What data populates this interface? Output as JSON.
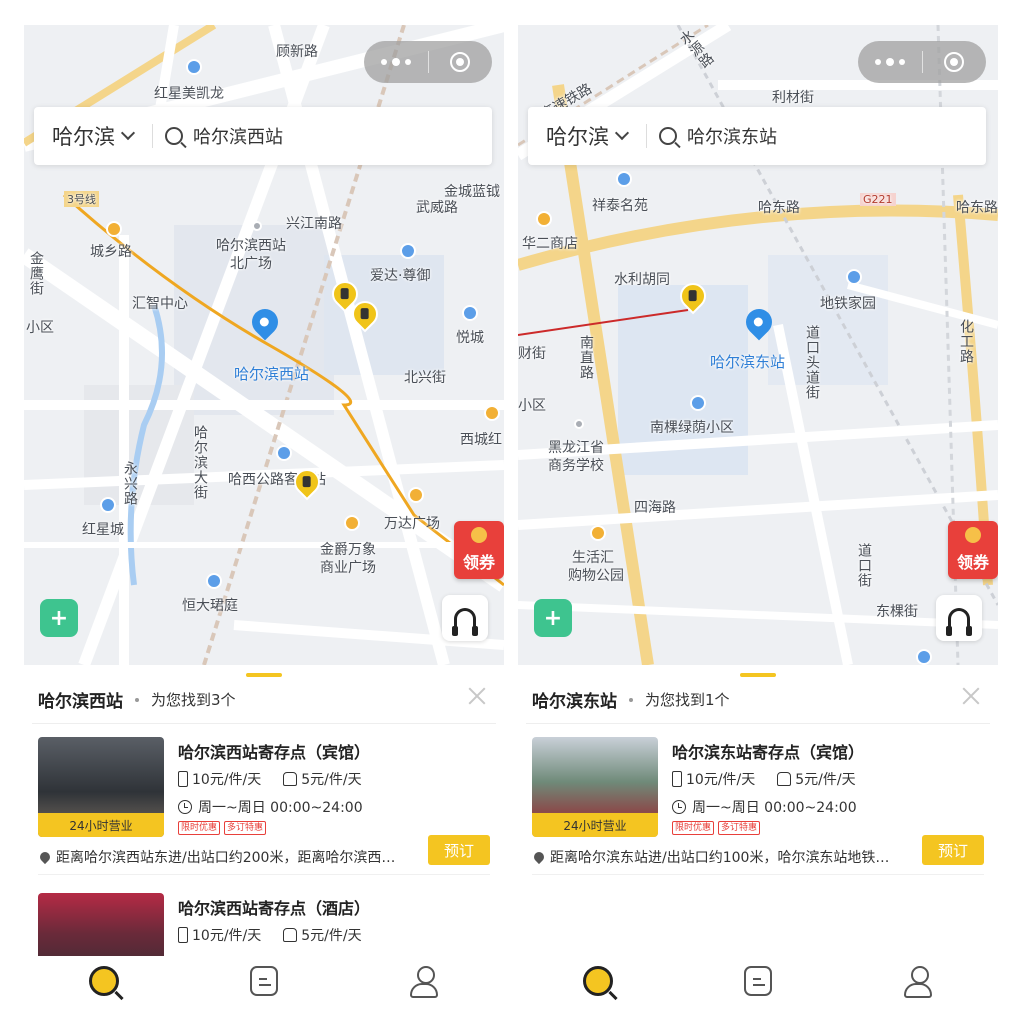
{
  "left": {
    "city": "哈尔滨",
    "search_text": "哈尔滨西站",
    "map_labels": {
      "l1": "红星美凯龙",
      "l2": "顾新路",
      "l3": "哈尔滨西站",
      "l4": "北广场",
      "l5": "兴江南路",
      "l6": "金城蓝钺",
      "l7": "城乡路",
      "l8": "汇智中心",
      "l9": "爱达·尊御",
      "l10": "武威路",
      "l11": "哈尔滨西站",
      "l12": "悦城",
      "l13": "北兴街",
      "l14": "西城红",
      "l15": "哈西公路客运站",
      "l16": "红星城",
      "l17": "万达广场",
      "l18": "金爵万象",
      "l19": "商业广场",
      "l20": "恒大珺庭",
      "l21": "哈尔滨大街",
      "l22": "永兴路",
      "l23": "3号线",
      "l24": "小区",
      "l25": "金鹰街"
    },
    "sheet_title": "哈尔滨西站",
    "sheet_sub": "为您找到3个",
    "cards": [
      {
        "name": "哈尔滨西站寄存点（宾馆）",
        "price_luggage": "10元/件/天",
        "price_bag": "5元/件/天",
        "hours": "周一~周日 00:00~24:00",
        "tag": "24小时营业",
        "badge1": "限时优惠",
        "badge2": "多订特惠",
        "address": "距离哈尔滨西站东进/出站口约200米，距离哈尔滨西…",
        "book": "预订"
      },
      {
        "name": "哈尔滨西站寄存点（酒店）",
        "price_luggage": "10元/件/天",
        "price_bag": "5元/件/天"
      }
    ],
    "coupon": "领券"
  },
  "right": {
    "city": "哈尔滨",
    "search_text": "哈尔滨东站",
    "map_labels": {
      "r1": "水源路",
      "r2": "利材街",
      "r3": "祥泰名苑",
      "r4": "哈东路",
      "r5": "哈东路",
      "r6": "华二商店",
      "r7": "水利胡同",
      "r8": "地铁家园",
      "r9": "哈尔滨东站",
      "r10": "南直路",
      "r11": "道口头道街",
      "r12": "化工路",
      "r13": "南棵绿荫小区",
      "r14": "黑龙江省",
      "r15": "商务学校",
      "r16": "四海路",
      "r17": "生活汇",
      "r18": "购物公园",
      "r19": "道口街",
      "r20": "东棵街",
      "r21": "财街",
      "r22": "G221",
      "r23": "小区",
      "r24": "高速铁路"
    },
    "sheet_title": "哈尔滨东站",
    "sheet_sub": "为您找到1个",
    "cards": [
      {
        "name": "哈尔滨东站寄存点（宾馆）",
        "price_luggage": "10元/件/天",
        "price_bag": "5元/件/天",
        "hours": "周一~周日 00:00~24:00",
        "tag": "24小时营业",
        "badge1": "限时优惠",
        "badge2": "多订特惠",
        "address": "距离哈尔滨东站进/出站口约100米，哈尔滨东站地铁…",
        "book": "预订"
      }
    ],
    "coupon": "领券"
  }
}
